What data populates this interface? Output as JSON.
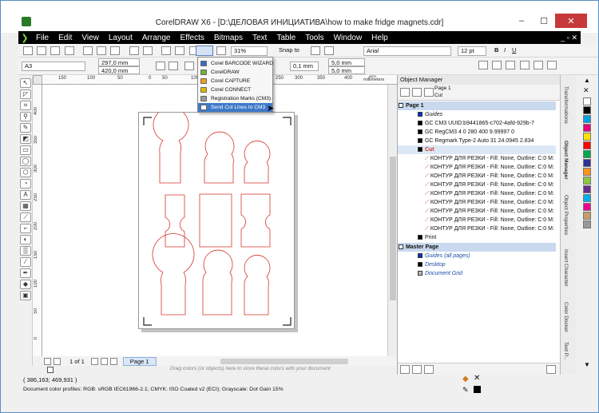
{
  "window": {
    "title": "CorelDRAW X6 - [D:\\ДЕЛОВАЯ ИНИЦИАТИВА\\how to make fridge magnets.cdr]",
    "controls": {
      "minimize": "–",
      "maximize": "☐",
      "close": "✕"
    }
  },
  "menu": {
    "items": [
      "File",
      "Edit",
      "View",
      "Layout",
      "Arrange",
      "Effects",
      "Bitmaps",
      "Text",
      "Table",
      "Tools",
      "Window",
      "Help"
    ],
    "doc_controls": "_ ▫ ✕"
  },
  "toolbar": {
    "zoom": "31%",
    "snap_to": "Snap to",
    "font": "Arial",
    "font_size": "12 pt"
  },
  "propertybar": {
    "page_size": "A3",
    "width": "297,0 mm",
    "height": "420,0 mm",
    "nudge": "0,1 mm",
    "dup_x": "5,0 mm",
    "dup_y": "5,0 mm"
  },
  "dropdown": {
    "items": [
      {
        "label": "Corel BARCODE WIZARD",
        "color": "#3b6cc4",
        "highlight": false
      },
      {
        "label": "CorelDRAW",
        "color": "#6bb33b",
        "highlight": false
      },
      {
        "label": "Corel CAPTURE",
        "color": "#f0a020",
        "highlight": false
      },
      {
        "label": "Corel CONNECT",
        "color": "#e0b800",
        "highlight": false
      },
      {
        "label": "Registration Marks (CM3)",
        "color": "#999999",
        "highlight": false
      },
      {
        "label": "Send Cut Lines to CM3",
        "color": "#ffffff",
        "highlight": true
      }
    ]
  },
  "ruler": {
    "unit": "millimeters",
    "h_ticks": [
      "150",
      "100",
      "50",
      "0",
      "50",
      "100",
      "150",
      "200",
      "250",
      "300",
      "350",
      "400",
      "450"
    ],
    "v_ticks": [
      "400",
      "350",
      "300",
      "250",
      "200",
      "150",
      "100",
      "50",
      "0"
    ]
  },
  "pagenav": {
    "page_count": "1 of 1",
    "page_tab": "Page 1"
  },
  "colorstrip": {
    "hint": "Drag colors (or objects) here to store these colors with your document"
  },
  "status": {
    "coords": "( 386,163; 469,931 )",
    "profile": "Document color profiles: RGB: sRGB IEC61966-2.1; CMYK: ISO Coated v2 (ECI); Grayscale: Dot Gain 15%"
  },
  "objmgr": {
    "title": "Object Manager",
    "current_page": "Page 1",
    "current_layer": "Cut",
    "page1": "Page 1",
    "rows": [
      {
        "text": "Guides",
        "style": "italic",
        "swatch": "#0033cc",
        "indent": 24
      },
      {
        "text": "GC CM3 UUID:b9441865-c702-4afd-929b-7",
        "style": "normal",
        "swatch": "#000000",
        "indent": 24
      },
      {
        "text": "GC RegCM3 4 0 280 400 9.99997 0",
        "style": "normal",
        "swatch": "#000000",
        "indent": 24
      },
      {
        "text": "GC Regmark Type-2 Auto 31 24.0945 2.834",
        "style": "normal",
        "swatch": "#000000",
        "indent": 24
      },
      {
        "text": "Cut",
        "style": "cut",
        "swatch": "#000000",
        "indent": 24
      },
      {
        "text": "КОНТУР ДЛЯ РЕЗКИ - Fill: None, Outline: C:0 M:",
        "style": "normal",
        "swatch": "",
        "indent": 34
      },
      {
        "text": "КОНТУР ДЛЯ РЕЗКИ - Fill: None, Outline: C:0 M:",
        "style": "normal",
        "swatch": "",
        "indent": 34
      },
      {
        "text": "КОНТУР ДЛЯ РЕЗКИ - Fill: None, Outline: C:0 M:",
        "style": "normal",
        "swatch": "",
        "indent": 34
      },
      {
        "text": "КОНТУР ДЛЯ РЕЗКИ - Fill: None, Outline: C:0 M:",
        "style": "normal",
        "swatch": "",
        "indent": 34
      },
      {
        "text": "КОНТУР ДЛЯ РЕЗКИ - Fill: None, Outline: C:0 M:",
        "style": "normal",
        "swatch": "",
        "indent": 34
      },
      {
        "text": "КОНТУР ДЛЯ РЕЗКИ - Fill: None, Outline: C:0 M:",
        "style": "normal",
        "swatch": "",
        "indent": 34
      },
      {
        "text": "КОНТУР ДЛЯ РЕЗКИ - Fill: None, Outline: C:0 M:",
        "style": "normal",
        "swatch": "",
        "indent": 34
      },
      {
        "text": "КОНТУР ДЛЯ РЕЗКИ - Fill: None, Outline: C:0 M:",
        "style": "normal",
        "swatch": "",
        "indent": 34
      },
      {
        "text": "КОНТУР ДЛЯ РЕЗКИ - Fill: None, Outline: C:0 M:",
        "style": "normal",
        "swatch": "",
        "indent": 34
      },
      {
        "text": "Print",
        "style": "normal",
        "swatch": "#000000",
        "indent": 24
      }
    ],
    "master": "Master Page",
    "master_rows": [
      "Guides (all pages)",
      "Desktop",
      "Document Grid"
    ]
  },
  "dockers": [
    "Transformations",
    "Object Manager",
    "Object Properties",
    "Insert Character",
    "Color Docker",
    "Text P..."
  ],
  "palette": [
    "#ffffff",
    "#000000",
    "#00a0e0",
    "#e0007a",
    "#ffe100",
    "#ff0000",
    "#00a650",
    "#2e3192",
    "#f7941d",
    "#8dc63f",
    "#662d91",
    "#00aeef",
    "#ec008c",
    "#c69c6d",
    "#999999"
  ],
  "colors": {
    "accent": "#3e79c8",
    "cut": "#d8342a",
    "menubar": "#000000"
  }
}
